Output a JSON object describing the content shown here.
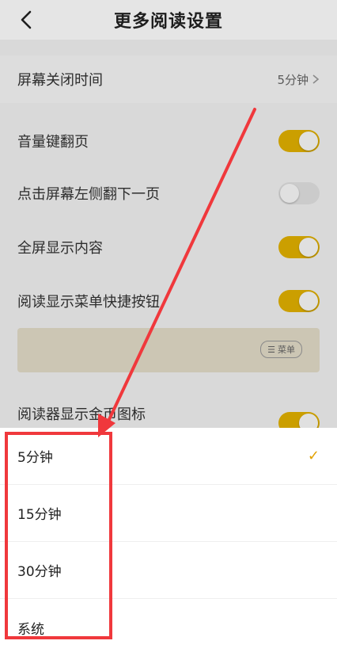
{
  "header": {
    "title": "更多阅读设置"
  },
  "settings": {
    "screen_off": {
      "label": "屏幕关闭时间",
      "value": "5分钟"
    },
    "volume_flip": {
      "label": "音量键翻页",
      "on": true
    },
    "tap_left": {
      "label": "点击屏幕左侧翻下一页",
      "on": false
    },
    "fullscreen": {
      "label": "全屏显示内容",
      "on": true
    },
    "menu_shortcut": {
      "label": "阅读显示菜单快捷按钮",
      "on": true,
      "chip": "菜单"
    },
    "coin_icon": {
      "label": "阅读器显示金币图标"
    }
  },
  "options": [
    {
      "label": "5分钟",
      "selected": true
    },
    {
      "label": "15分钟",
      "selected": false
    },
    {
      "label": "30分钟",
      "selected": false
    },
    {
      "label": "系统",
      "selected": false
    }
  ],
  "colors": {
    "accent": "#e2b100",
    "highlight": "#f0383c"
  }
}
